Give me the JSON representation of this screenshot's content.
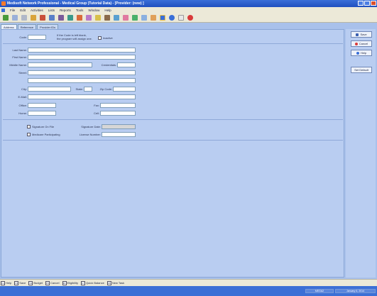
{
  "window": {
    "title": "Medisoft Network Professional - Medical Group (Tutorial Data) - [Provider: (new) ]"
  },
  "menu": [
    "File",
    "Edit",
    "Activities",
    "Lists",
    "Reports",
    "Tools",
    "Window",
    "Help"
  ],
  "tabs": [
    "Address",
    "Reference",
    "Provider IDs"
  ],
  "form": {
    "code_label": "Code:",
    "code_hint_1": "If the Code is left blank,",
    "code_hint_2": "the program will assign one.",
    "inactive_label": "Inactive",
    "last_name_label": "Last Name:",
    "first_name_label": "First Name:",
    "middle_name_label": "Middle Name:",
    "credentials_label": "Credentials:",
    "street_label": "Street:",
    "city_label": "City:",
    "state_label": "State:",
    "zip_label": "Zip Code:",
    "email_label": "E-Mail:",
    "office_label": "Office:",
    "fax_label": "Fax:",
    "home_label": "Home:",
    "cell_label": "Cell:",
    "signature_on_file_label": "Signature On File",
    "signature_date_label": "Signature Date:",
    "medicare_participating_label": "Medicare Participating",
    "license_number_label": "License Number:"
  },
  "buttons": {
    "save": "Save",
    "cancel": "Cancel",
    "help": "Help",
    "set_default": "Set Default"
  },
  "fkeys": [
    {
      "key": "F1",
      "label": "Help"
    },
    {
      "key": "F3",
      "label": "Save"
    },
    {
      "key": "F4",
      "label": "Budget"
    },
    {
      "key": "F5",
      "label": "Cancel"
    },
    {
      "key": "F6",
      "label": "Eligibility"
    },
    {
      "key": "F7",
      "label": "Quick Balance"
    },
    {
      "key": "F8",
      "label": "New Task"
    }
  ],
  "status": {
    "db": "MEGA2",
    "date": "January 6, 2014"
  }
}
